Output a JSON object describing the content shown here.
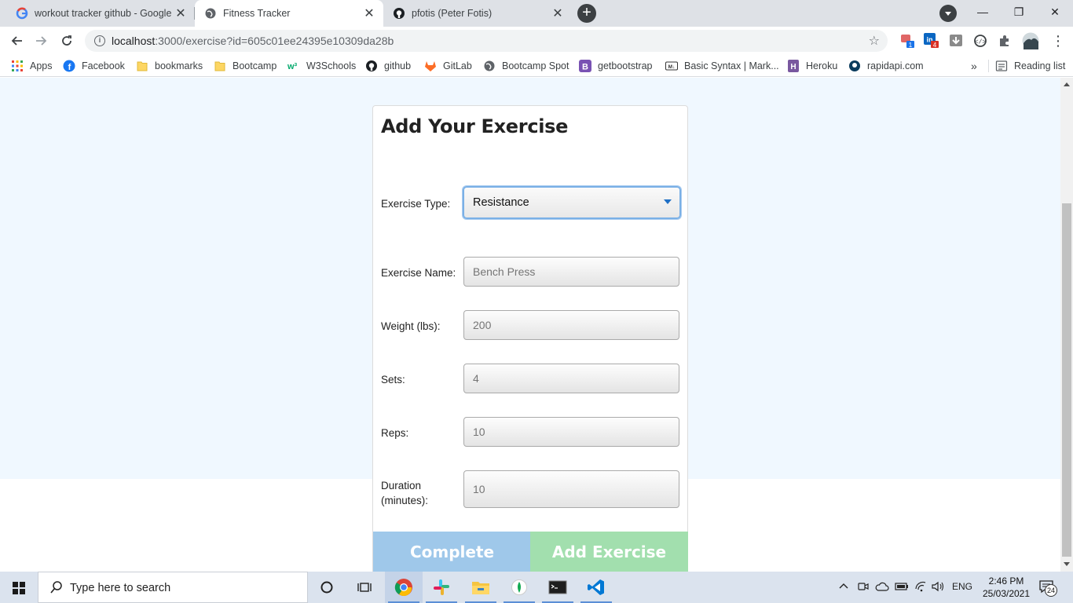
{
  "browser": {
    "tabs": [
      {
        "title": "workout tracker github - Google",
        "icon": "google-icon",
        "active": false
      },
      {
        "title": "Fitness Tracker",
        "icon": "globe-icon",
        "active": true
      },
      {
        "title": "pfotis (Peter Fotis)",
        "icon": "github-icon",
        "active": false
      }
    ],
    "new_tab_label": "+",
    "url_host": "localhost",
    "url_rest": ":3000/exercise?id=605c01ee24395e10309da28b",
    "window_controls": {
      "minimize": "—",
      "restore": "❐",
      "close": "✕"
    },
    "extension_badges": {
      "ext1": "1",
      "ext2": "4"
    },
    "bookmarks": [
      {
        "label": "Apps",
        "icon": "apps-grid-icon"
      },
      {
        "label": "Facebook",
        "icon": "facebook-icon"
      },
      {
        "label": "bookmarks",
        "icon": "folder-icon"
      },
      {
        "label": "Bootcamp",
        "icon": "folder-icon"
      },
      {
        "label": "W3Schools",
        "icon": "w3schools-icon"
      },
      {
        "label": "github",
        "icon": "github-icon"
      },
      {
        "label": "GitLab",
        "icon": "gitlab-icon"
      },
      {
        "label": "Bootcamp Spot",
        "icon": "globe-icon"
      },
      {
        "label": "getbootstrap",
        "icon": "bootstrap-icon"
      },
      {
        "label": "Basic Syntax | Mark...",
        "icon": "markdown-icon"
      },
      {
        "label": "Heroku",
        "icon": "heroku-icon"
      },
      {
        "label": "rapidapi.com",
        "icon": "rapidapi-icon"
      }
    ],
    "bookmarks_overflow": "»",
    "reading_list": "Reading list"
  },
  "form": {
    "title": "Add Your Exercise",
    "type_label": "Exercise Type:",
    "type_value": "Resistance",
    "name_label": "Exercise Name:",
    "name_placeholder": "Bench Press",
    "weight_label": "Weight (lbs):",
    "weight_placeholder": "200",
    "sets_label": "Sets:",
    "sets_placeholder": "4",
    "reps_label": "Reps:",
    "reps_placeholder": "10",
    "duration_label": "Duration (minutes):",
    "duration_placeholder": "10",
    "complete_button": "Complete",
    "add_button": "Add Exercise"
  },
  "taskbar": {
    "search_placeholder": "Type here to search",
    "language": "ENG",
    "time": "2:46 PM",
    "date": "25/03/2021",
    "notification_count": "24"
  },
  "colors": {
    "page_background": "#f0f8ff",
    "complete_button": "#9fc8ea",
    "add_button": "#a2dfae",
    "select_focus": "#7ab0e6"
  }
}
